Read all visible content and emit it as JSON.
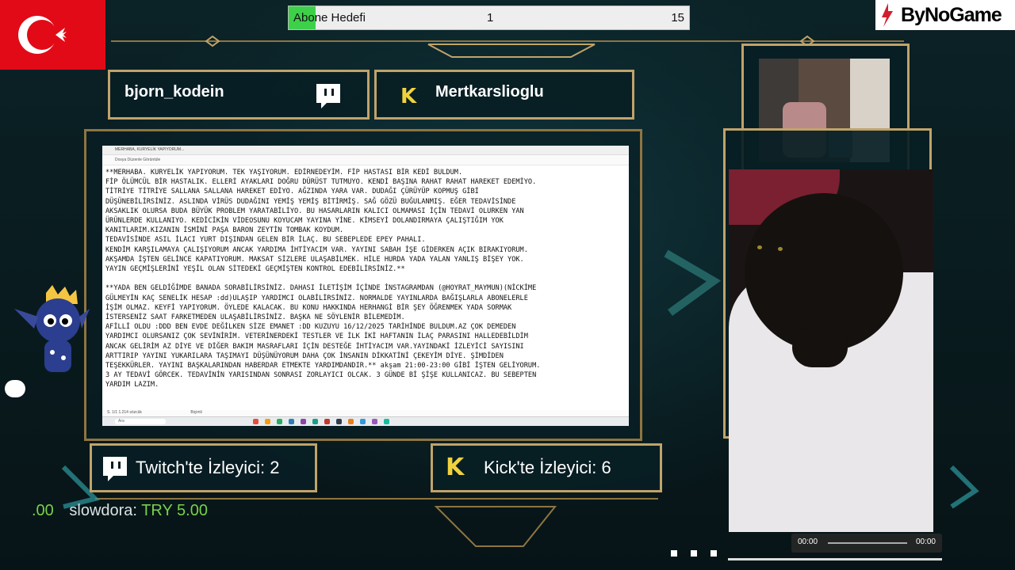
{
  "subscriber_goal": {
    "label": "Abone Hedefi",
    "current": "1",
    "target": "15",
    "progress": 0.0667
  },
  "brand": {
    "logo_text": "ByNoGame"
  },
  "streamers": {
    "twitch_name": "bjorn_kodein",
    "kick_name": "Mertkarslioglu"
  },
  "document": {
    "tab_title": "MERHABA, KURYELİK YAPIYORUM...",
    "menu": "Dosya   Düzenle   Görüntüle",
    "text": "**MERHABA. KURYELİK YAPIYORUM. TEK YAŞIYORUM. EDİRNEDEYİM. FİP HASTASI BİR KEDİ BULDUM.\nFİP ÖLÜMCÜL BİR HASTALIK. ELLERİ AYAKLARI DOĞRU DÜRÜST TUTMUYO. KENDİ BAŞINA RAHAT RAHAT HAREKET EDEMİYO.\nTİTRİYE TİTRİYE SALLANA SALLANA HAREKET EDİYO. AĞZINDA YARA VAR. DUDAĞI ÇÜRÜYÜP KOPMUŞ GİBİ\nDÜŞÜNEBİLİRSİNİZ. ASLINDA VİRÜS DUDAĞINI YEMİŞ YEMİŞ BİTİRMİŞ. SAĞ GÖZÜ BUĞULANMIŞ. EĞER TEDAVİSİNDE\nAKSAKLIK OLURSA BUDA BÜYÜK PROBLEM YARATABİLİYO. BU HASARLARIN KALICI OLMAMASI İÇİN TEDAVİ OLURKEN YAN\nÜRÜNLERDE KULLANIYO. KEDİCİKİN VİDEOSUNU KOYUCAM YAYINA YİNE. KİMSEYİ DOLANDIRMAYA ÇALIŞTIĞIM YOK\nKANITLARIM.KIZANIN İSMİNİ PAŞA BARON ZEYTİN TOMBAK KOYDUM.\nTEDAVİSİNDE ASIL İLACI YURT DIŞINDAN GELEN BİR İLAÇ. BU SEBEPLEDE EPEY PAHALI.\nKENDİM KARŞILAMAYA ÇALIŞIYORUM ANCAK YARDIMA İHTİYACIM VAR. YAYINI SABAH İŞE GİDERKEN AÇIK BIRAKIYORUM.\nAKŞAMDA İŞTEN GELİNCE KAPATIYORUM. MAKSAT SİZLERE ULAŞABİLMEK. HİLE HURDA YADA YALAN YANLIŞ BİŞEY YOK.\nYAYIN GEÇMİŞLERİNİ YEŞİL OLAN SİTEDEKİ GEÇMİŞTEN KONTROL EDEBİLİRSİNİZ.**\n\n**YADA BEN GELDİĞİMDE BANADA SORABİLİRSİNİZ. DAHASI İLETİŞİM İÇİNDE İNSTAGRAMDAN (@HOYRAT_MAYMUN)(NİCKİME\nGÜLMEYİN KAÇ SENELİK HESAP :dd)ULAŞIP YARDIMCI OLABİLİRSİNİZ. NORMALDE YAYINLARDA BAĞIŞLARLA ABONELERLE\nİŞİM OLMAZ. KEYFİ YAPIYORUM. ÖYLEDE KALACAK. BU KONU HAKKINDA HERHANGİ BİR ŞEY ÖĞRENMEK YADA SORMAK\nİSTERSENİZ SAAT FARKETMEDEN ULAŞABİLİRSİNİZ. BAŞKA NE SÖYLENİR BİLEMEDİM.\nAFİLLİ OLDU :DDD BEN EVDE DEĞİLKEN SİZE EMANET :DD KUZUYU 16/12/2025 TARİHİNDE BULDUM.AZ ÇOK DEMEDEN\nYARDIMCI OLURSANIZ ÇOK SEVİNİRİM. VETERİNERDEKİ TESTLER VE İLK İKİ HAFTANIN İLAÇ PARASINI HALLEDEBİLDİM\nANCAK GELİRİM AZ DİYE VE DİĞER BAKIM MASRAFLARI İÇİN DESTEĞE İHTİYACIM VAR.YAYINDAKİ İZLEYİCİ SAYISINI\nARTTIRIP YAYINI YUKARILARA TAŞIMAYI DÜŞÜNÜYORUM DAHA ÇOK İNSANIN DİKKATİNİ ÇEKEYİM DİYE. ŞİMDİDEN\nTEŞEKKÜRLER. YAYINI BAŞKALARINDAN HABERDAR ETMEKTE YARDIMDANDIR.** akşam 21:00-23:00 GİBİ İŞTEN GELİYORUM.\n3 AY TEDAVİ GÖRCEK. TEDAVİNİN YARISINDAN SONRASI ZORLAYICI OLCAK. 3 GÜNDE Bİ ŞİŞE KULLANICAZ. BU SEBEPTEN\nYARDIM LAZIM.",
    "status_left": "S. 1/1   1.214 sözcük",
    "status_mid": "Biçimli",
    "search_placeholder": "Ara"
  },
  "viewers": {
    "twitch_label": "Twitch'te İzleyici: 2",
    "kick_label": "Kick'te İzleyici: 6"
  },
  "chat": {
    "prefix": ".00",
    "user": "slowdora:",
    "amount": "TRY 5.00"
  },
  "video": {
    "time_current": "00:00",
    "time_total": "00:00"
  },
  "colors": {
    "gold": "#c1a36a",
    "twitch": "#9146ff",
    "kick": "#53fc18",
    "goal_fill": "#3dd14a",
    "flag_red": "#e30a17"
  },
  "icons": [
    "turkey-flag-icon",
    "twitch-icon",
    "kick-icon",
    "mascot-icon",
    "bynogame-logo-icon"
  ]
}
